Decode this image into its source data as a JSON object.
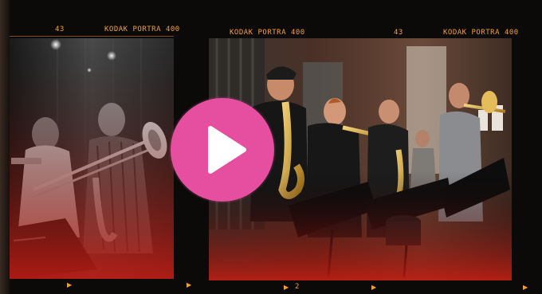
{
  "film": {
    "left_frame": {
      "frame_number": "43",
      "brand": "KODAK  PORTRA 400"
    },
    "right_frame": {
      "brand_left": "KODAK  PORTRA 400",
      "frame_number": "43",
      "brand_right": "KODAK  PORTRA 400"
    },
    "bottom": {
      "counter": "2"
    }
  },
  "video": {
    "play_icon": "play-icon"
  },
  "colors": {
    "play_button": "#e64fa0",
    "edge_marking": "#f0a030"
  }
}
